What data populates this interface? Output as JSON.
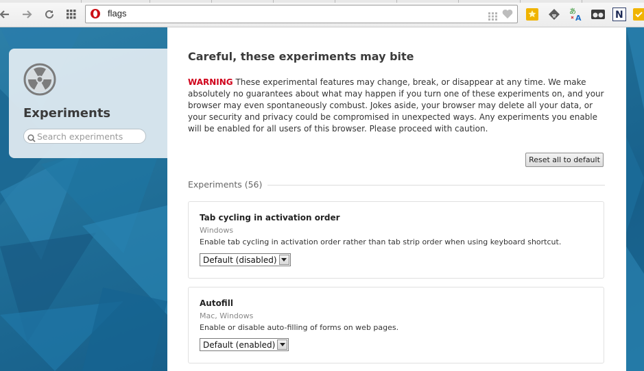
{
  "toolbar": {
    "address": "flags",
    "icons": [
      "back-arrow-icon",
      "forward-arrow-icon",
      "reload-icon",
      "speed-dial-icon",
      "opera-logo-icon",
      "tiles-icon",
      "heart-icon"
    ],
    "extensions": [
      "star-extension-icon",
      "feedly-icon",
      "translate-icon",
      "glasses-icon",
      "notes-n-icon",
      "checkmark-extension-icon"
    ]
  },
  "sidebar": {
    "title": "Experiments",
    "search_placeholder": "Search experiments"
  },
  "main": {
    "heading": "Careful, these experiments may bite",
    "warning_label": "WARNING",
    "warning_text": " These experimental features may change, break, or disappear at any time. We make absolutely no guarantees about what may happen if you turn one of these experiments on, and your browser may even spontaneously combust. Jokes aside, your browser may delete all your data, or your security and privacy could be compromised in unexpected ways. Any experiments you enable will be enabled for all users of this browser. Please proceed with caution.",
    "reset_button": "Reset all to default",
    "section_label": "Experiments (56)",
    "experiments": [
      {
        "title": "Tab cycling in activation order",
        "platforms": "Windows",
        "description": "Enable tab cycling in activation order rather than tab strip order when using keyboard shortcut.",
        "value": "Default (disabled)"
      },
      {
        "title": "Autofill",
        "platforms": "Mac, Windows",
        "description": "Enable or disable auto-filling of forms on web pages.",
        "value": "Default (enabled)"
      }
    ]
  },
  "colors": {
    "warning": "#d0021b",
    "background_blue": "#1f6d96",
    "opera_red": "#cc0f16"
  }
}
